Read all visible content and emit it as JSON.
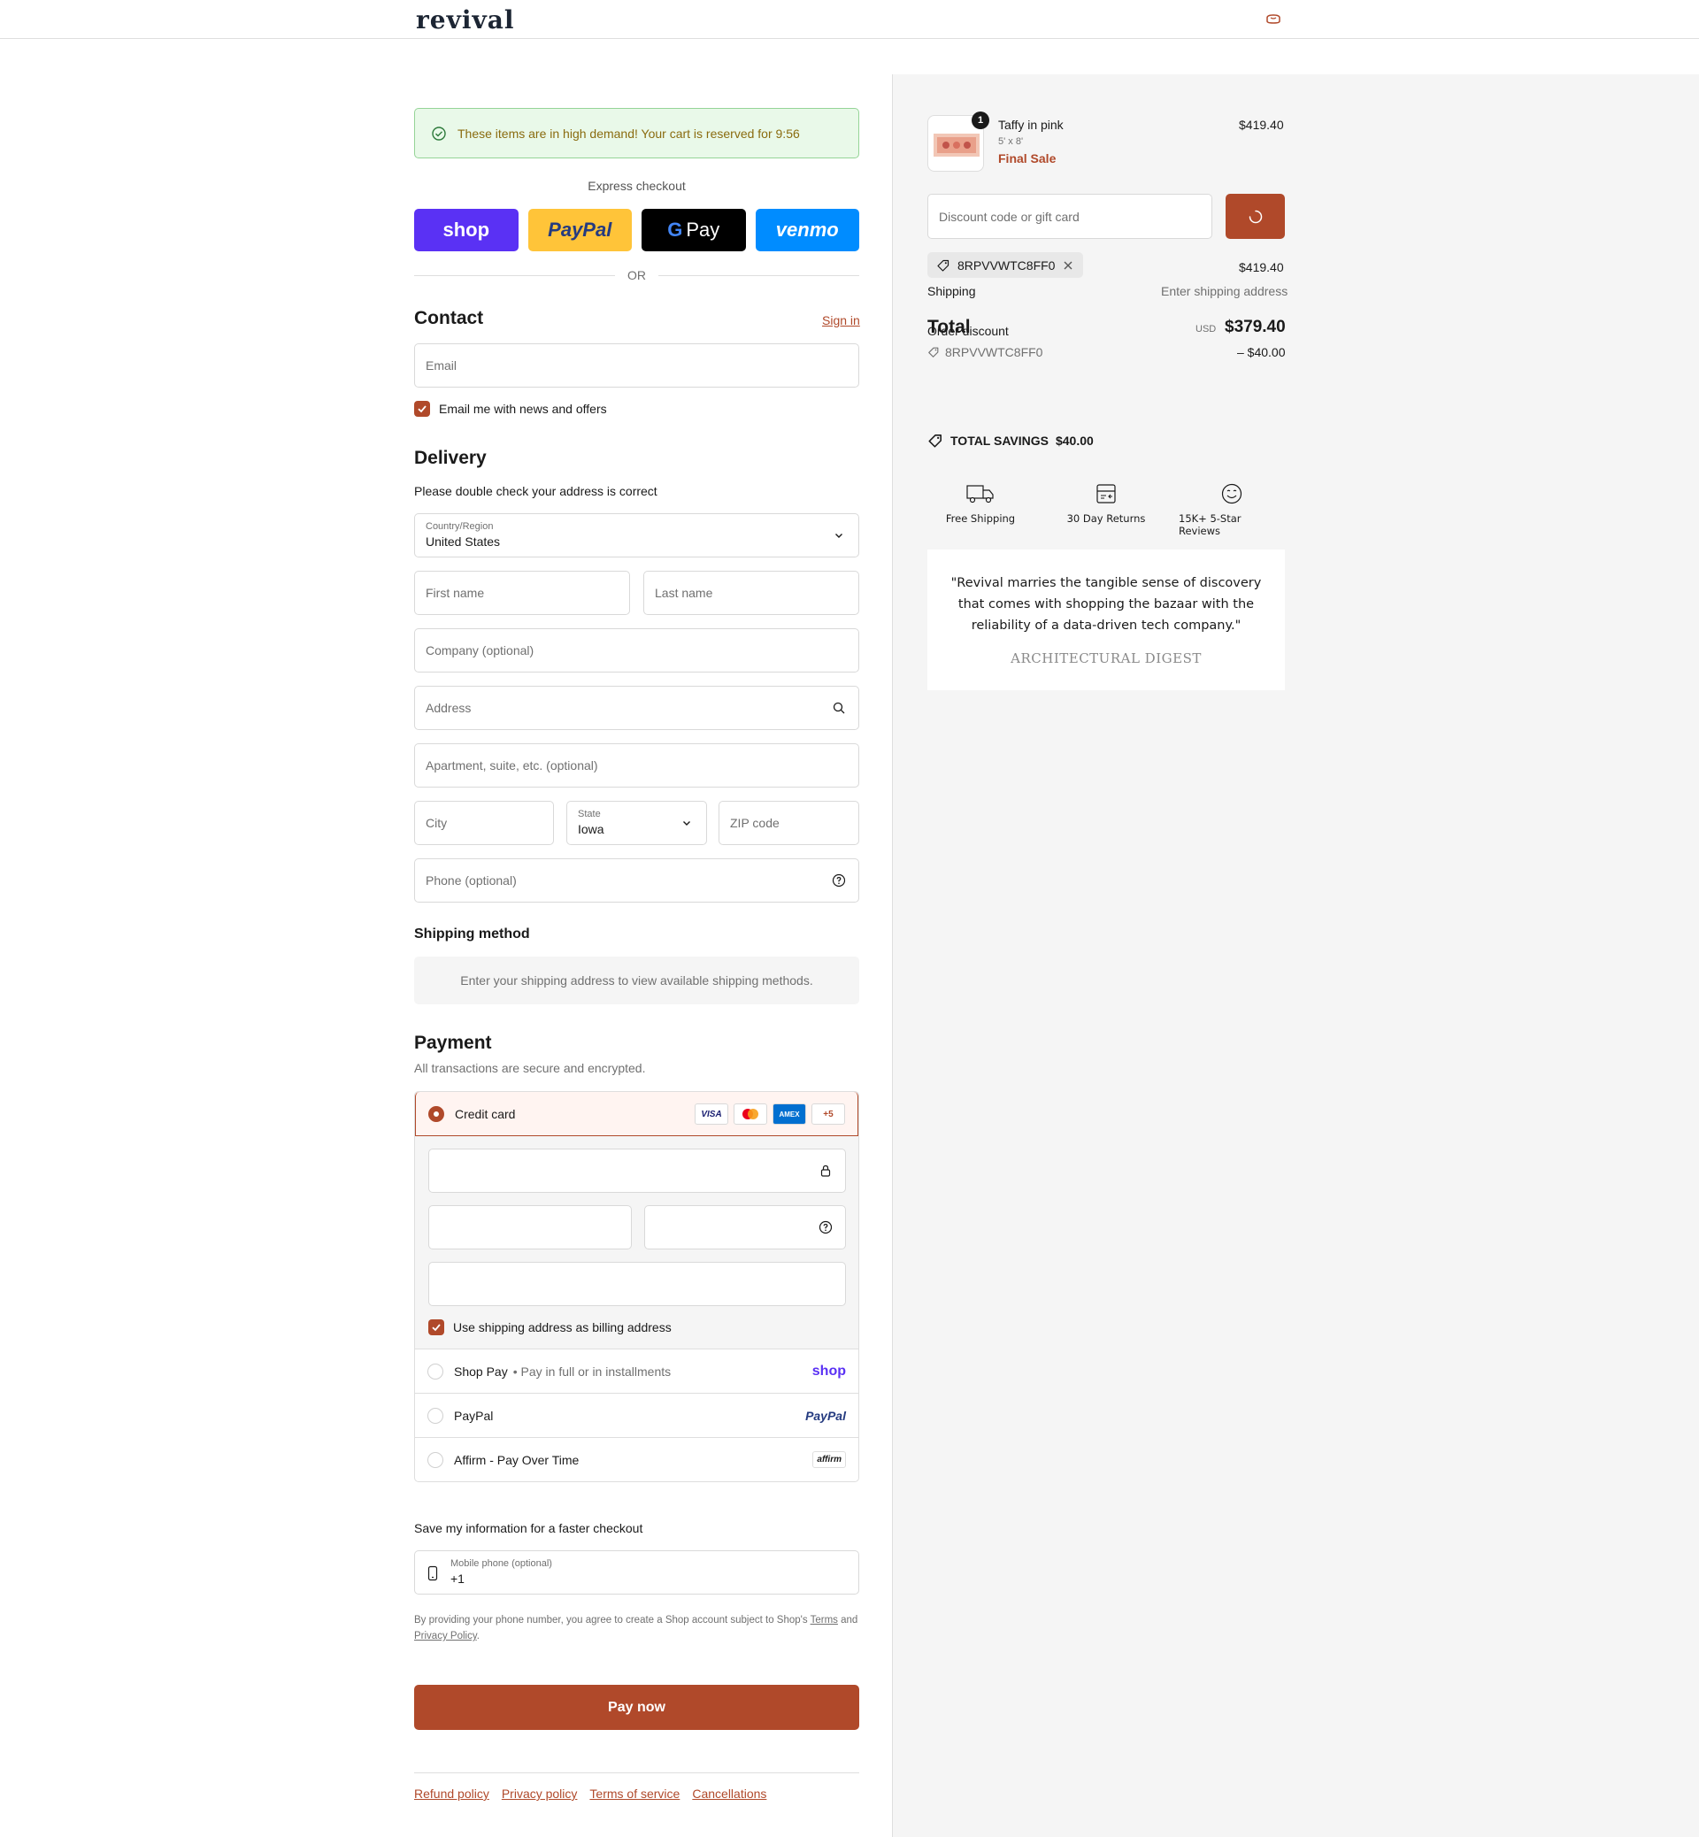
{
  "header": {
    "logo": "revival",
    "cart_icon": "bag-icon"
  },
  "banner": {
    "text": "These items are in high demand! Your cart is reserved for 9:56",
    "icon": "check-circle-icon"
  },
  "express": {
    "label": "Express checkout",
    "buttons": [
      "shop",
      "PayPal",
      "Pay",
      "venmo"
    ],
    "or": "OR"
  },
  "contact": {
    "title": "Contact",
    "sign_in": "Sign in",
    "email_placeholder": "Email",
    "newsletter": "Email me with news and offers"
  },
  "delivery": {
    "title": "Delivery",
    "note": "Please double check your address is correct",
    "country_label": "Country/Region",
    "country_value": "United States",
    "first_name": "First name",
    "last_name": "Last name",
    "company": "Company (optional)",
    "address": "Address",
    "apartment": "Apartment, suite, etc. (optional)",
    "city": "City",
    "state_label": "State",
    "state_value": "Iowa",
    "zip": "ZIP code",
    "phone": "Phone (optional)"
  },
  "shipping_method": {
    "title": "Shipping method",
    "message": "Enter your shipping address to view available shipping methods."
  },
  "payment": {
    "title": "Payment",
    "subtitle": "All transactions are secure and encrypted.",
    "credit_card": "Credit card",
    "card_brands": [
      "VISA",
      "MC",
      "AMEX",
      "+5"
    ],
    "billing_same": "Use shipping address as billing address",
    "shop_pay": "Shop Pay",
    "shop_pay_sub": "Pay in full or in installments",
    "shop_pay_logo": "shop",
    "paypal": "PayPal",
    "paypal_logo": "PayPal",
    "affirm": "Affirm - Pay Over Time",
    "affirm_logo": "affirm"
  },
  "save_info": {
    "title": "Save my information for a faster checkout",
    "mobile_label": "Mobile phone (optional)",
    "mobile_value": "+1",
    "disclaimer_pre": "By providing your phone number, you agree to create a Shop account subject to Shop's ",
    "terms": "Terms",
    "and": " and ",
    "privacy": "Privacy Policy",
    "period": "."
  },
  "pay_now": "Pay now",
  "footer_links": [
    "Refund policy",
    "Privacy policy",
    "Terms of service",
    "Cancellations"
  ],
  "summary": {
    "item_name": "Taffy in pink",
    "item_size": "5' x 8'",
    "item_tag": "Final Sale",
    "item_price": "$419.40",
    "quantity": "1",
    "discount_placeholder": "Discount code or gift card",
    "applied_code": "8RPVVWTC8FF0",
    "subtotal_value": "$419.40",
    "shipping_label": "Shipping",
    "shipping_value": "Enter shipping address",
    "order_discount_label": "Order discount",
    "total_label": "Total",
    "total_currency": "USD",
    "total_value": "$379.40",
    "discount_code": "8RPVVWTC8FF0",
    "discount_value": "– $40.00",
    "savings_label": "TOTAL SAVINGS",
    "savings_value": "$40.00",
    "perks": [
      "Free Shipping",
      "30 Day Returns",
      "15K+ 5-Star Reviews"
    ],
    "quote": "\"Revival marries the tangible sense of discovery that comes with shopping the bazaar with the reliability of a data-driven tech company.\"",
    "quote_source": "ARCHITECTURAL DIGEST"
  },
  "colors": {
    "accent": "#b0492a",
    "shop": "#5a31f4",
    "paypal": "#ffc439",
    "venmo": "#008cff"
  }
}
